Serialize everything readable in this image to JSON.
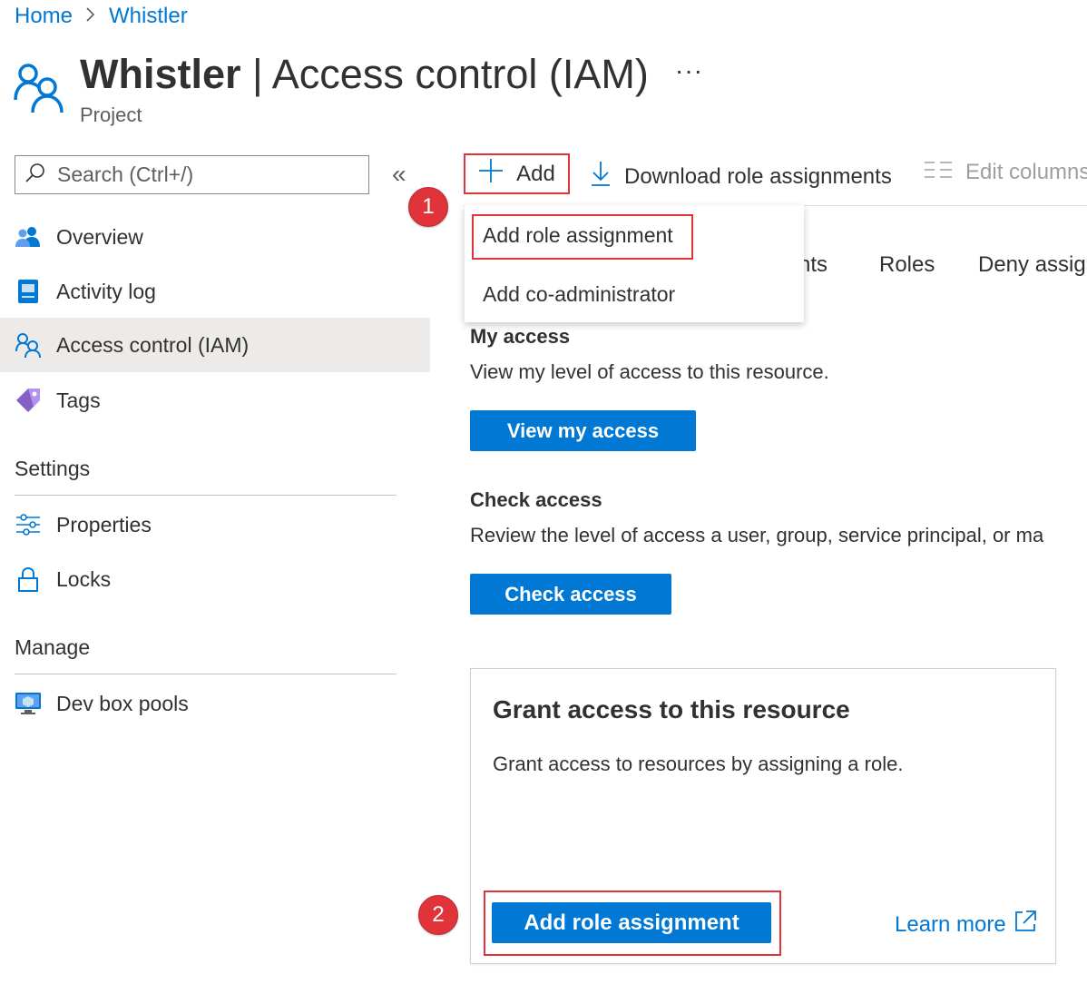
{
  "breadcrumb": {
    "home": "Home",
    "separator": ">",
    "current": "Whistler"
  },
  "header": {
    "resource_name": "Whistler",
    "separator": "|",
    "page_name": "Access control (IAM)",
    "more": "···",
    "subtitle": "Project"
  },
  "search": {
    "placeholder": "Search (Ctrl+/)",
    "collapse": "«"
  },
  "nav": {
    "items": [
      {
        "label": "Overview",
        "icon": "overview-users-icon"
      },
      {
        "label": "Activity log",
        "icon": "activity-log-icon"
      },
      {
        "label": "Access control (IAM)",
        "icon": "iam-people-icon",
        "selected": true
      },
      {
        "label": "Tags",
        "icon": "tag-icon"
      }
    ],
    "settings_heading": "Settings",
    "settings_items": [
      {
        "label": "Properties",
        "icon": "sliders-icon"
      },
      {
        "label": "Locks",
        "icon": "lock-icon"
      }
    ],
    "manage_heading": "Manage",
    "manage_items": [
      {
        "label": "Dev box pools",
        "icon": "dev-box-icon"
      }
    ]
  },
  "toolbar": {
    "add": "Add",
    "download": "Download role assignments",
    "edit_columns": "Edit columns"
  },
  "tabs": {
    "partial": "nts",
    "roles": "Roles",
    "deny": "Deny assig"
  },
  "add_menu": {
    "items": [
      "Add role assignment",
      "Add co-administrator"
    ]
  },
  "badges": {
    "step1": "1",
    "step2": "2"
  },
  "my_access": {
    "heading": "My access",
    "description": "View my level of access to this resource.",
    "button": "View my access"
  },
  "check_access": {
    "heading": "Check access",
    "description": "Review the level of access a user, group, service principal, or ma",
    "button": "Check access"
  },
  "grant_card": {
    "title": "Grant access to this resource",
    "description": "Grant access to resources by assigning a role.",
    "button": "Add role assignment",
    "learn_more": "Learn more"
  },
  "colors": {
    "accent": "#0078d4",
    "highlight": "#e0343a",
    "selected_bg": "#edebe9"
  }
}
